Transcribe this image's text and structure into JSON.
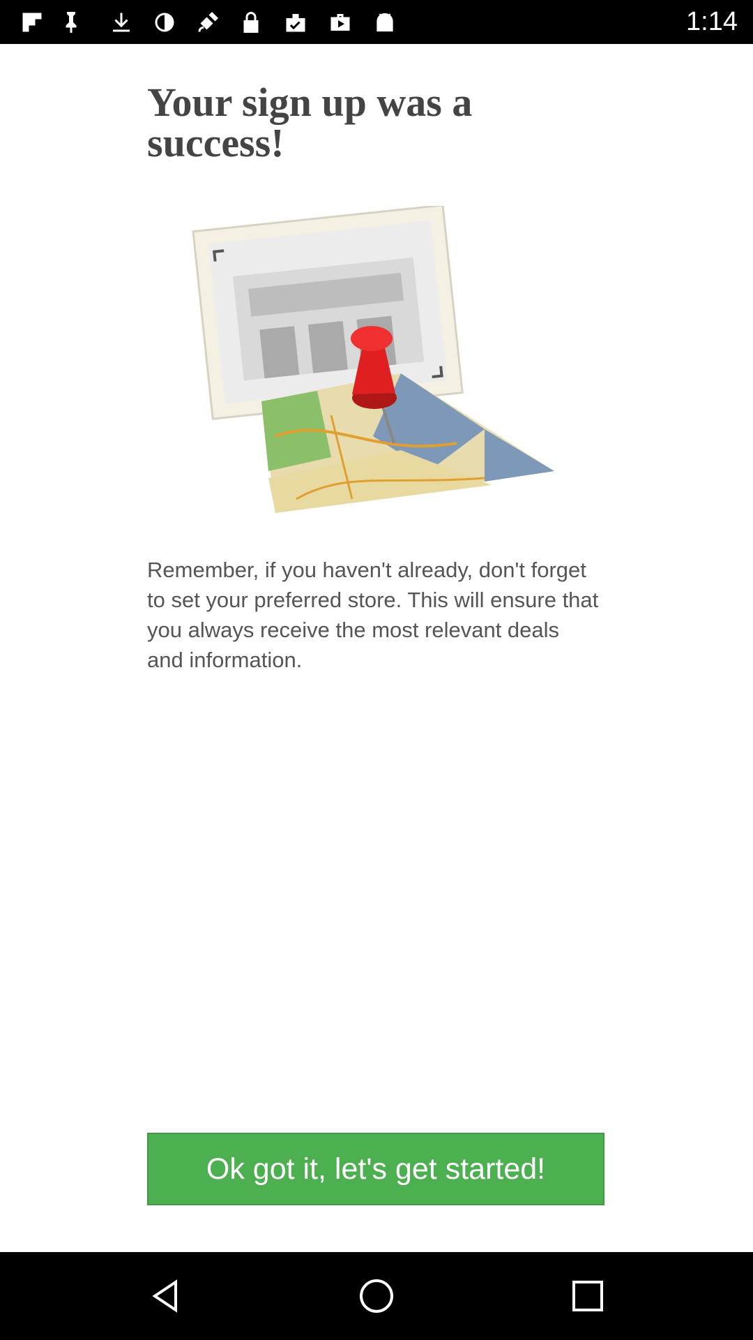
{
  "status_bar": {
    "time": "1:14",
    "icons": [
      "flipboard-icon",
      "download-icon",
      "sync-icon",
      "satellite-icon",
      "lock-icon",
      "clipboard-check-icon",
      "briefcase-icon",
      "android-icon",
      "wifi-icon",
      "signal-icon",
      "battery-icon"
    ]
  },
  "main": {
    "title": "Your sign up was a success!",
    "illustration_icon": "store-map-pin-illustration",
    "message": "Remember, if you haven't already, don't forget to set your preferred store. This will ensure that you always receive the most relevant deals and information.",
    "cta_label": "Ok got it, let's get started!"
  },
  "nav": {
    "back": "back-icon",
    "home": "home-icon",
    "recents": "recents-icon"
  },
  "colors": {
    "accent": "#4caf50",
    "title": "#444444",
    "text": "#555555",
    "pin": "#e02020"
  }
}
